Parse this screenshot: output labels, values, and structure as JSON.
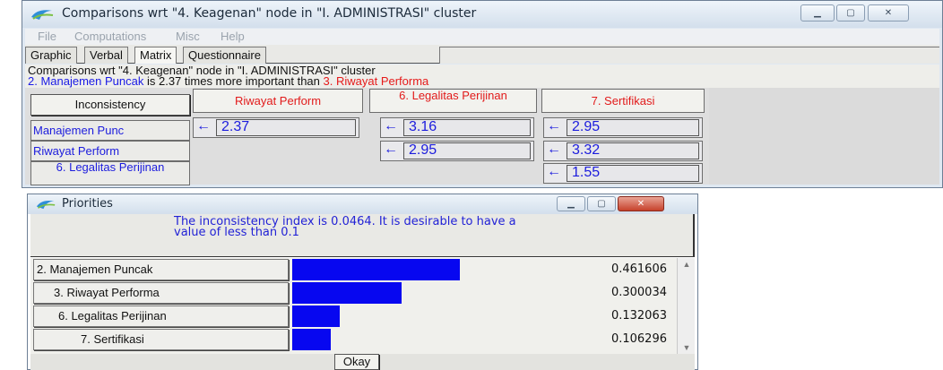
{
  "main_window": {
    "title": "Comparisons wrt \"4. Keagenan\" node in \"I. ADMINISTRASI\" cluster",
    "menu": [
      "File",
      "Computations",
      "Misc",
      "Help"
    ],
    "tabs": [
      {
        "label": "Graphic",
        "active": false
      },
      {
        "label": "Verbal",
        "active": false
      },
      {
        "label": "Matrix",
        "active": true
      },
      {
        "label": "Questionnaire",
        "active": false
      }
    ],
    "info_line1": "Comparisons wrt \"4. Keagenan\" node in \"I. ADMINISTRASI\" cluster",
    "info_line2": {
      "item_a": "2. Manajemen Puncak",
      "middle": " is 2.37 times more important than ",
      "item_b": "3. Riwayat Performa"
    },
    "inconsistency_button": "Inconsistency",
    "column_headers": [
      "Riwayat Perform",
      "6. Legalitas Perijinan",
      "7. Sertifikasi"
    ],
    "row_headers": [
      "Manajemen Punc",
      "Riwayat Perform",
      "6. Legalitas Perijinan"
    ],
    "cells": {
      "r0c0": "2.37",
      "r0c1": "3.16",
      "r0c2": "2.95",
      "r1c1": "2.95",
      "r1c2": "3.32",
      "r2c2": "1.55"
    },
    "arrow_glyph": "←"
  },
  "priorities_window": {
    "title": "Priorities",
    "message": "The inconsistency index is 0.0464.  It is desirable to have a value of less than 0.1",
    "items": [
      {
        "label": "2. Manajemen Puncak",
        "value": 0.461606,
        "value_text": "0.461606"
      },
      {
        "label": "3. Riwayat Performa",
        "value": 0.300034,
        "value_text": "0.300034"
      },
      {
        "label": "6. Legalitas Perijinan",
        "value": 0.132063,
        "value_text": "0.132063"
      },
      {
        "label": "7. Sertifikasi",
        "value": 0.106296,
        "value_text": "0.106296"
      }
    ],
    "okay_button": "Okay"
  },
  "colors": {
    "accent_blue": "#1c1cdd",
    "accent_red": "#e21b1b",
    "bar_blue": "#0707f0"
  }
}
